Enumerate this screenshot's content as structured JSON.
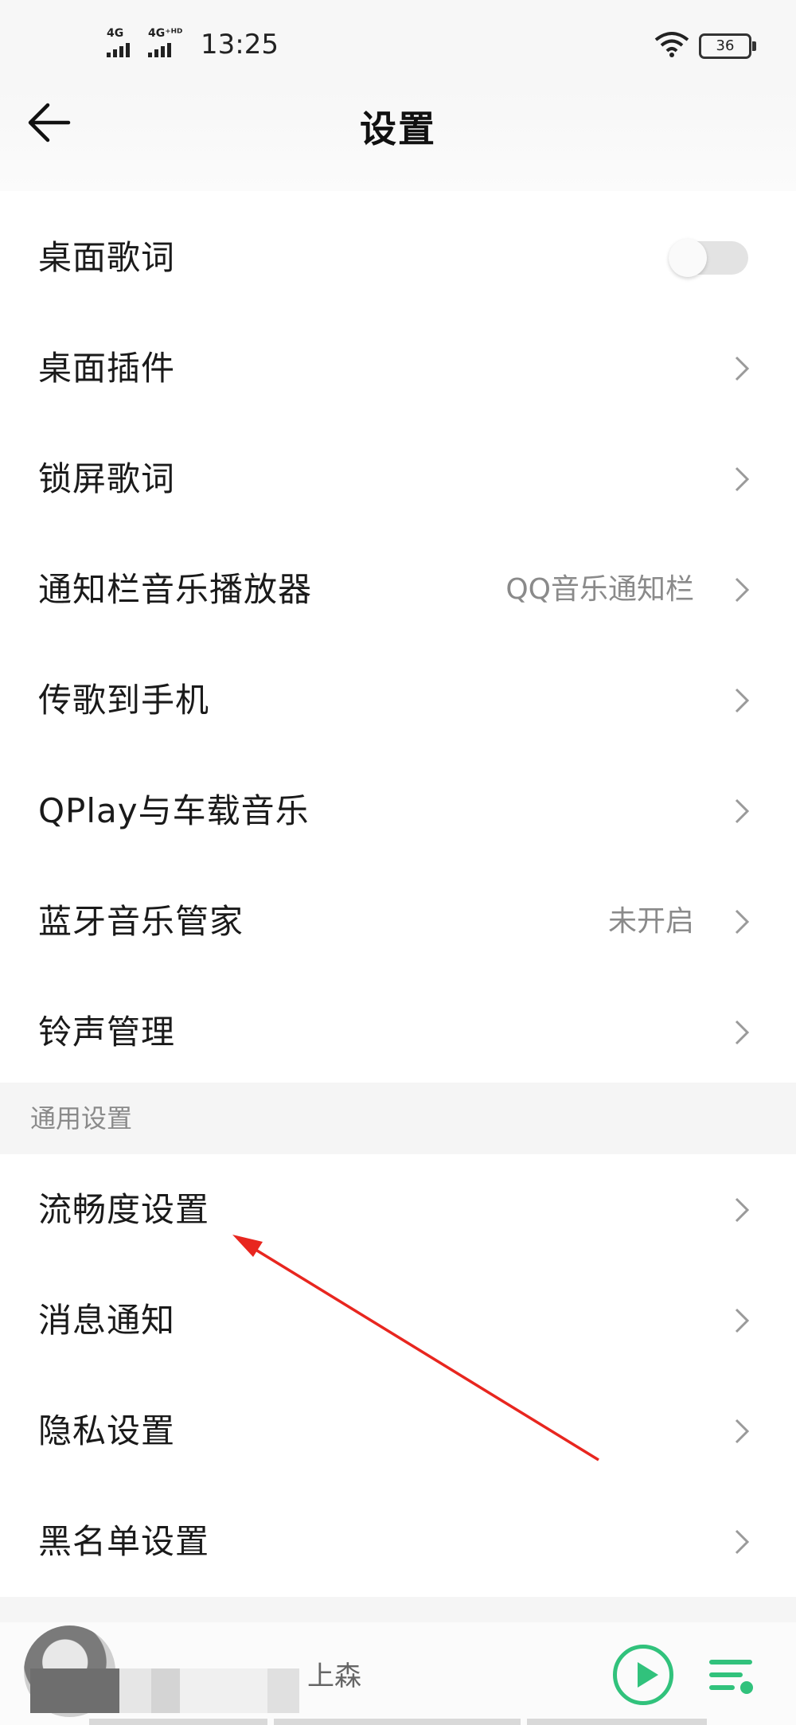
{
  "status_bar": {
    "signal_1": "4G",
    "signal_2": "4G⁺ᴴᴰ",
    "time": "13:25",
    "battery": "36"
  },
  "header": {
    "title": "设置"
  },
  "settings_group_1": [
    {
      "label": "桌面歌词",
      "control": "toggle",
      "on": false
    },
    {
      "label": "桌面插件",
      "control": "chevron"
    },
    {
      "label": "锁屏歌词",
      "control": "chevron"
    },
    {
      "label": "通知栏音乐播放器",
      "value": "QQ音乐通知栏",
      "control": "chevron"
    },
    {
      "label": "传歌到手机",
      "control": "chevron"
    },
    {
      "label": "QPlay与车载音乐",
      "control": "chevron"
    },
    {
      "label": "蓝牙音乐管家",
      "value": "未开启",
      "control": "chevron"
    },
    {
      "label": "铃声管理",
      "control": "chevron"
    }
  ],
  "general_section": {
    "title": "通用设置",
    "items": [
      {
        "label": "流畅度设置",
        "control": "chevron"
      },
      {
        "label": "消息通知",
        "control": "chevron"
      },
      {
        "label": "隐私设置",
        "control": "chevron"
      },
      {
        "label": "黑名单设置",
        "control": "chevron"
      }
    ]
  },
  "mini_player": {
    "track_text": "上森"
  },
  "colors": {
    "accent_green": "#31c27c",
    "annotation_red": "#e8261f",
    "secondary_text": "#8a8a8a"
  }
}
